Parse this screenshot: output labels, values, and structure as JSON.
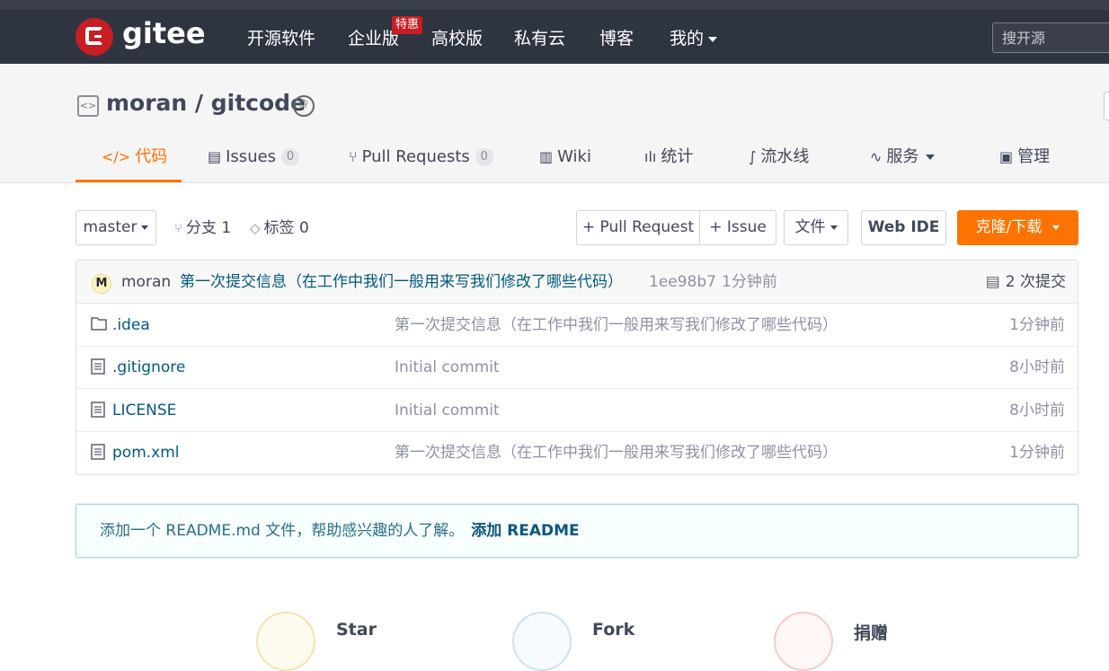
{
  "topnav": {
    "brand": "gitee",
    "items": [
      "开源软件",
      "企业版",
      "高校版",
      "私有云",
      "博客",
      "我的"
    ],
    "promo_badge": "特惠",
    "search_placeholder": "搜开源"
  },
  "repo": {
    "title": "moran / gitcode"
  },
  "tabs": [
    {
      "label": "代码",
      "icon": "code-icon"
    },
    {
      "label": "Issues",
      "count": "0",
      "icon": "issues-icon"
    },
    {
      "label": "Pull Requests",
      "count": "0",
      "icon": "pull-request-icon"
    },
    {
      "label": "Wiki",
      "icon": "book-icon"
    },
    {
      "label": "统计",
      "icon": "bar-chart-icon"
    },
    {
      "label": "流水线",
      "icon": "pipeline-icon"
    },
    {
      "label": "服务",
      "icon": "pulse-icon"
    },
    {
      "label": "管理",
      "icon": "settings-doc-icon"
    }
  ],
  "toolbar": {
    "branch": "master",
    "branches_label": "分支 1",
    "tags_label": "标签 0",
    "pull_request_btn": "+ Pull Request",
    "issue_btn": "+ Issue",
    "file_btn": "文件",
    "webide_btn": "Web IDE",
    "clone_btn": "克隆/下载"
  },
  "latest_commit": {
    "avatar_letter": "M",
    "author": "moran",
    "message": "第一次提交信息（在工作中我们一般用来写我们修改了哪些代码）",
    "hash": "1ee98b7",
    "time": "1分钟前",
    "commits_count": "2 次提交"
  },
  "files": [
    {
      "name": ".idea",
      "type": "folder",
      "message": "第一次提交信息（在工作中我们一般用来写我们修改了哪些代码）",
      "time": "1分钟前"
    },
    {
      "name": ".gitignore",
      "type": "file",
      "message": "Initial commit",
      "time": "8小时前"
    },
    {
      "name": "LICENSE",
      "type": "file",
      "message": "Initial commit",
      "time": "8小时前"
    },
    {
      "name": "pom.xml",
      "type": "file",
      "message": "第一次提交信息（在工作中我们一般用来写我们修改了哪些代码）",
      "time": "1分钟前"
    }
  ],
  "readme_notice": {
    "text": "添加一个 README.md 文件，帮助感兴趣的人了解。",
    "link": "添加 README"
  },
  "stats": [
    {
      "label": "Star"
    },
    {
      "label": "Fork"
    },
    {
      "label": "捐赠"
    }
  ],
  "colors": {
    "accent": "#fe7300",
    "nav_bg": "#2e3440",
    "brand_red": "#c71d23",
    "link": "#005980"
  }
}
